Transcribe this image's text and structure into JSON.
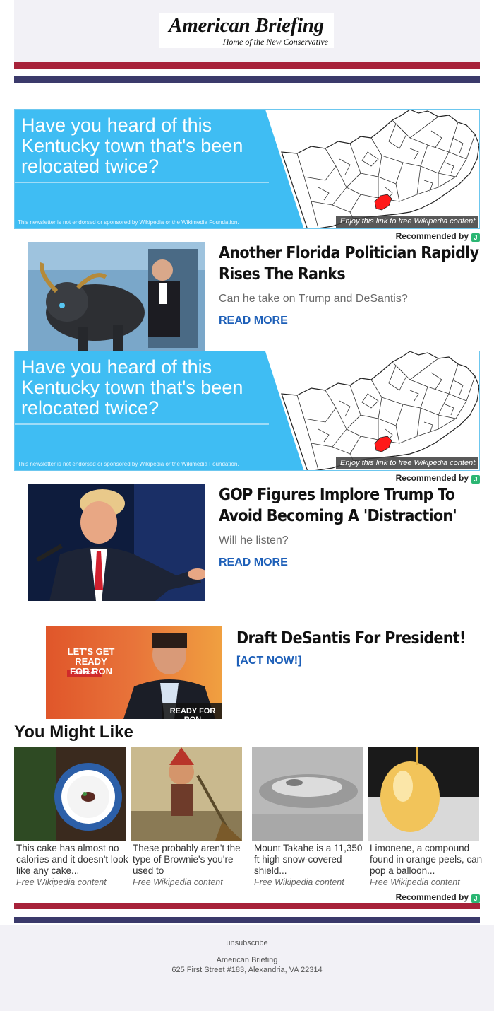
{
  "header": {
    "brand": "American Briefing",
    "tagline": "Home of the New Conservative"
  },
  "colors": {
    "stripe_red": "#a7223a",
    "stripe_navy": "#3b3a6b",
    "ad_blue": "#3fbdf3",
    "link_blue": "#1d5fb8",
    "highlight_county": "#ff1a1a"
  },
  "wiki_ad": {
    "headline": "Have you heard of this Kentucky town that's been relocated twice?",
    "disclaimer": "This newsletter is not endorsed or sponsored by Wikipedia or the Wikimedia Foundation.",
    "caption": "Enjoy this link to free Wikipedia content.",
    "recommended": "Recommended by",
    "badge": "J"
  },
  "articles": [
    {
      "title": "Another Florida Politician Rapidly Rises The Ranks",
      "subtitle": "Can he take on Trump and DeSantis?",
      "cta": "READ MORE"
    },
    {
      "title": "GOP Figures Implore Trump To Avoid Becoming A 'Distraction'",
      "subtitle": "Will he listen?",
      "cta": "READ MORE"
    }
  ],
  "promo": {
    "title": "Draft DeSantis For President!",
    "cta": "[ACT NOW!]",
    "image_text_1": "LET'S GET READY",
    "image_text_2": "FOR RON",
    "image_button": "JOIN TODAY",
    "image_badge": "READY FOR RON"
  },
  "you_might_like": {
    "title": "You Might Like",
    "cards": [
      {
        "text": "This cake has almost no calories and it doesn't look like any cake...",
        "source": "Free Wikipedia content",
        "icon": "plate-photo"
      },
      {
        "text": "These probably aren't the type of Brownie's you're used to",
        "source": "Free Wikipedia content",
        "icon": "brownie-illustration"
      },
      {
        "text": "Mount Takahe is a 11,350 ft high snow-covered shield...",
        "source": "Free Wikipedia content",
        "icon": "mountain-photo"
      },
      {
        "text": "Limonene, a compound found in orange peels, can pop a balloon...",
        "source": "Free Wikipedia content",
        "icon": "balloon-photo"
      }
    ],
    "recommended": "Recommended by",
    "badge": "J"
  },
  "footer": {
    "unsubscribe": "unsubscribe",
    "company": "American Briefing",
    "address": "625 First Street #183, Alexandria, VA 22314"
  }
}
